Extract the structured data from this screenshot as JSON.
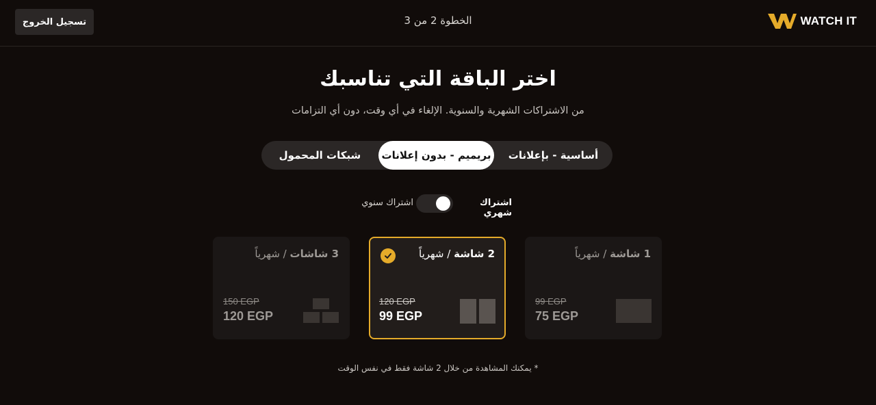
{
  "header": {
    "brand": "WATCH IT",
    "step": "الخطوة 2 من 3",
    "logout_label": "تسجيل الخروج"
  },
  "main": {
    "title": "اختر الباقة التي تناسبك",
    "subtitle": "من الاشتراكات الشهرية والسنوية. الإلغاء في أي وقت، دون أي التزامات"
  },
  "tabs": [
    {
      "label": "أساسية - بإعلانات",
      "selected": false
    },
    {
      "label": "بريميم - بدون إعلانات",
      "selected": true
    },
    {
      "label": "شبكات المحمول",
      "selected": false
    }
  ],
  "billing": {
    "monthly_label": "اشتراك شهري",
    "annual_label": "اشتراك سنوي",
    "selected": "monthly"
  },
  "plans": [
    {
      "screens": "1 شاشة",
      "period": "/ شهرياً",
      "old_price": "99 EGP",
      "price": "75 EGP",
      "selected": false
    },
    {
      "screens": "2 شاشة",
      "period": "/ شهرياً",
      "old_price": "120 EGP",
      "price": "99 EGP",
      "selected": true
    },
    {
      "screens": "3 شاشات",
      "period": "/ شهرياً",
      "old_price": "150 EGP",
      "price": "120 EGP",
      "selected": false
    }
  ],
  "note": "* يمكنك المشاهدة من خلال 2 شاشة فقط في نفس الوقت",
  "colors": {
    "background": "#110c0a",
    "accent": "#e5ab2a",
    "pill": "#2b2726"
  }
}
